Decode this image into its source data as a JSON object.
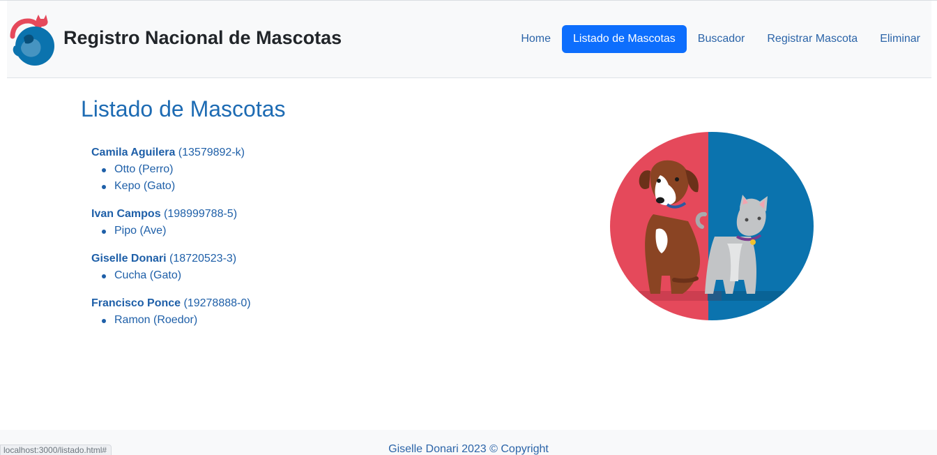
{
  "header": {
    "title": "Registro Nacional de Mascotas",
    "nav": [
      {
        "label": "Home"
      },
      {
        "label": "Listado de Mascotas"
      },
      {
        "label": "Buscador"
      },
      {
        "label": "Registrar Mascota"
      },
      {
        "label": "Eliminar"
      }
    ]
  },
  "main": {
    "title": "Listado de Mascotas",
    "owners": [
      {
        "name": "Camila Aguilera",
        "rut": "(13579892-k)",
        "pets": [
          "Otto (Perro)",
          "Kepo (Gato)"
        ]
      },
      {
        "name": "Ivan Campos",
        "rut": "(198999788-5)",
        "pets": [
          "Pipo (Ave)"
        ]
      },
      {
        "name": "Giselle Donari",
        "rut": "(18720523-3)",
        "pets": [
          "Cucha (Gato)"
        ]
      },
      {
        "name": "Francisco Ponce",
        "rut": "(19278888-0)",
        "pets": [
          "Ramon (Roedor)"
        ]
      }
    ]
  },
  "footer": {
    "text": "Giselle Donari 2023 © Copyright"
  },
  "status_bar": {
    "url": "localhost:3000/listado.html#"
  },
  "colors": {
    "accent": "#0d6efd",
    "link": "#2b64a8",
    "title": "#1d6bb3",
    "hero_red": "#e5495b",
    "hero_blue": "#0b73ae"
  }
}
